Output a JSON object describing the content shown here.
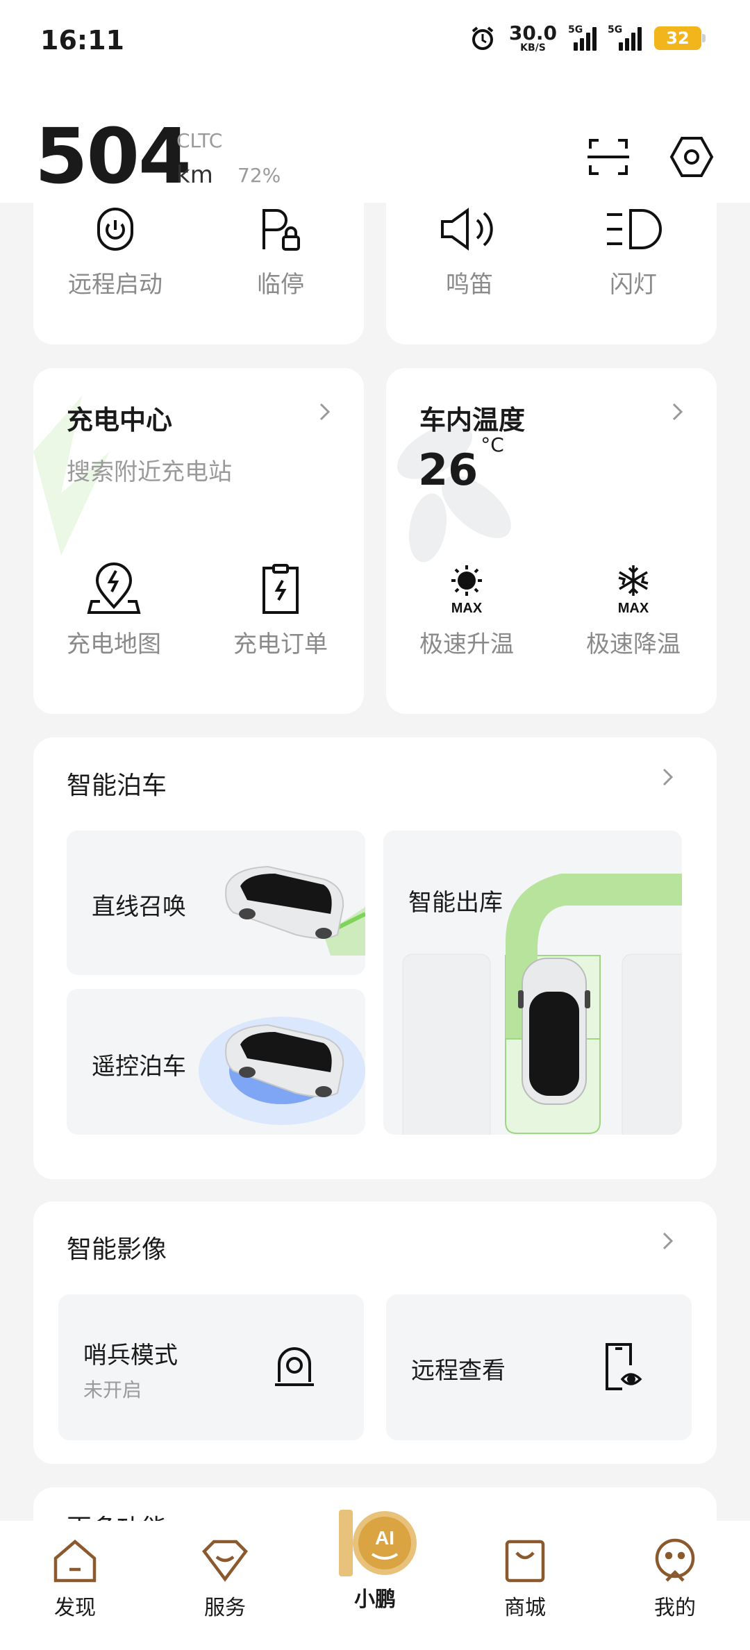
{
  "status_bar": {
    "time": "16:11",
    "net_speed": "30.0",
    "net_unit": "KB/S",
    "signal1_label": "5G",
    "signal2_label": "5G",
    "battery": "32"
  },
  "header": {
    "range_value": "504",
    "range_standard": "CLTC",
    "range_unit": "km",
    "battery_percent": "72%",
    "icons": [
      "scan-icon",
      "settings-icon"
    ]
  },
  "quick_controls": [
    {
      "label": "远程启动",
      "icon": "remote-start-icon"
    },
    {
      "label": "临停",
      "icon": "parking-lock-icon"
    },
    {
      "label": "鸣笛",
      "icon": "horn-icon"
    },
    {
      "label": "闪灯",
      "icon": "headlight-icon"
    }
  ],
  "charging": {
    "title": "充电中心",
    "subtitle": "搜索附近充电站",
    "items": [
      {
        "label": "充电地图",
        "icon": "charge-map-icon"
      },
      {
        "label": "充电订单",
        "icon": "charge-order-icon"
      }
    ]
  },
  "cabin": {
    "title": "车内温度",
    "temperature": "26",
    "temperature_unit": "°C",
    "items": [
      {
        "label": "极速升温",
        "icon": "max-heat-icon",
        "badge": "MAX"
      },
      {
        "label": "极速降温",
        "icon": "max-cool-icon",
        "badge": "MAX"
      }
    ]
  },
  "parking": {
    "title": "智能泊车",
    "tiles": [
      {
        "label": "直线召唤"
      },
      {
        "label": "遥控泊车"
      },
      {
        "label": "智能出库"
      }
    ]
  },
  "imaging": {
    "title": "智能影像",
    "tiles": [
      {
        "label": "哨兵模式",
        "status": "未开启",
        "icon": "sentry-camera-icon"
      },
      {
        "label": "远程查看",
        "icon": "remote-view-icon"
      }
    ]
  },
  "more": {
    "title_partial": "更多功能"
  },
  "bottom_nav": [
    {
      "label": "发现",
      "icon": "discover-icon"
    },
    {
      "label": "服务",
      "icon": "service-icon"
    },
    {
      "label": "小鹏",
      "icon": "xpeng-ai-icon",
      "badge": "AI",
      "active": true
    },
    {
      "label": "商城",
      "icon": "mall-icon"
    },
    {
      "label": "我的",
      "icon": "profile-icon"
    }
  ],
  "colors": {
    "accent_green": "#7ed35a",
    "battery": "#f2b51c",
    "ai_gold": "#d9a441",
    "park_blue": "#7ea6f4"
  }
}
